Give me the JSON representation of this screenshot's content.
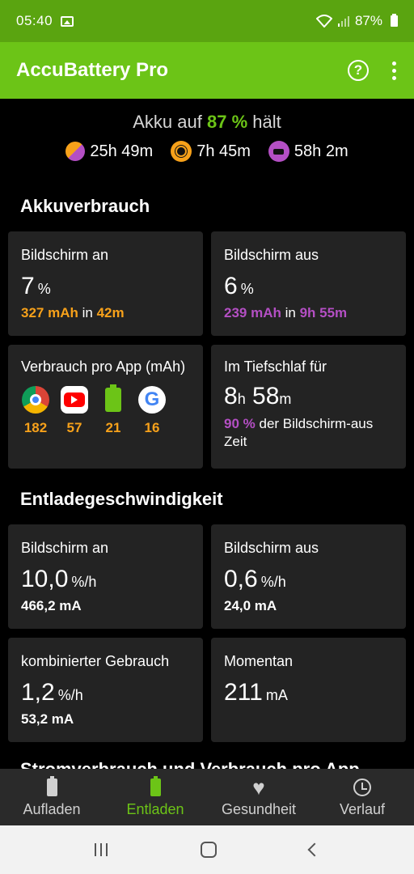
{
  "status_bar": {
    "time": "05:40",
    "battery": "87%"
  },
  "app_bar": {
    "title": "AccuBattery Pro"
  },
  "summary": {
    "prefix": "Akku auf",
    "percent": "87 %",
    "suffix": "hält",
    "estimates": [
      {
        "icon": "combined-usage-icon",
        "value": "25h 49m"
      },
      {
        "icon": "sun-icon",
        "value": "7h 45m"
      },
      {
        "icon": "sleep-icon",
        "value": "58h 2m"
      }
    ]
  },
  "sections": {
    "usage_title": "Akkuverbrauch",
    "rate_title": "Entladegeschwindigkeit",
    "cutoff_title": "Stromverbrauch und Verbrauch pro App"
  },
  "usage_cards": {
    "screen_on": {
      "label": "Bildschirm an",
      "value": "7",
      "unit": "%",
      "mah": "327 mAh",
      "in": "in",
      "duration": "42m"
    },
    "screen_off": {
      "label": "Bildschirm aus",
      "value": "6",
      "unit": "%",
      "mah": "239 mAh",
      "in": "in",
      "duration": "9h 55m"
    },
    "per_app": {
      "label": "Verbrauch pro App (mAh)",
      "apps": [
        {
          "icon": "chrome-icon",
          "value": "182"
        },
        {
          "icon": "youtube-icon",
          "value": "57"
        },
        {
          "icon": "accubattery-icon",
          "value": "21"
        },
        {
          "icon": "google-icon",
          "value": "16"
        }
      ]
    },
    "deep_sleep": {
      "label": "Im Tiefschlaf für",
      "hours": "8",
      "h": "h",
      "minutes": "58",
      "m": "m",
      "pct": "90 %",
      "text": "der Bildschirm-aus Zeit"
    }
  },
  "rate_cards": {
    "screen_on": {
      "label": "Bildschirm an",
      "value": "10,0",
      "unit": "%/h",
      "ma": "466,2 mA"
    },
    "screen_off": {
      "label": "Bildschirm aus",
      "value": "0,6",
      "unit": "%/h",
      "ma": "24,0 mA"
    },
    "combined": {
      "label": "kombinierter Gebrauch",
      "value": "1,2",
      "unit": "%/h",
      "ma": "53,2 mA"
    },
    "current": {
      "label": "Momentan",
      "value": "211",
      "unit": "mA"
    }
  },
  "bottom_nav": [
    {
      "label": "Aufladen",
      "active": false
    },
    {
      "label": "Entladen",
      "active": true
    },
    {
      "label": "Gesundheit",
      "active": false
    },
    {
      "label": "Verlauf",
      "active": false
    }
  ],
  "colors": {
    "accent": "#6cc417",
    "screen_on": "#f7a11a",
    "screen_off": "#b44fc4",
    "combined": "#9c5c46"
  }
}
